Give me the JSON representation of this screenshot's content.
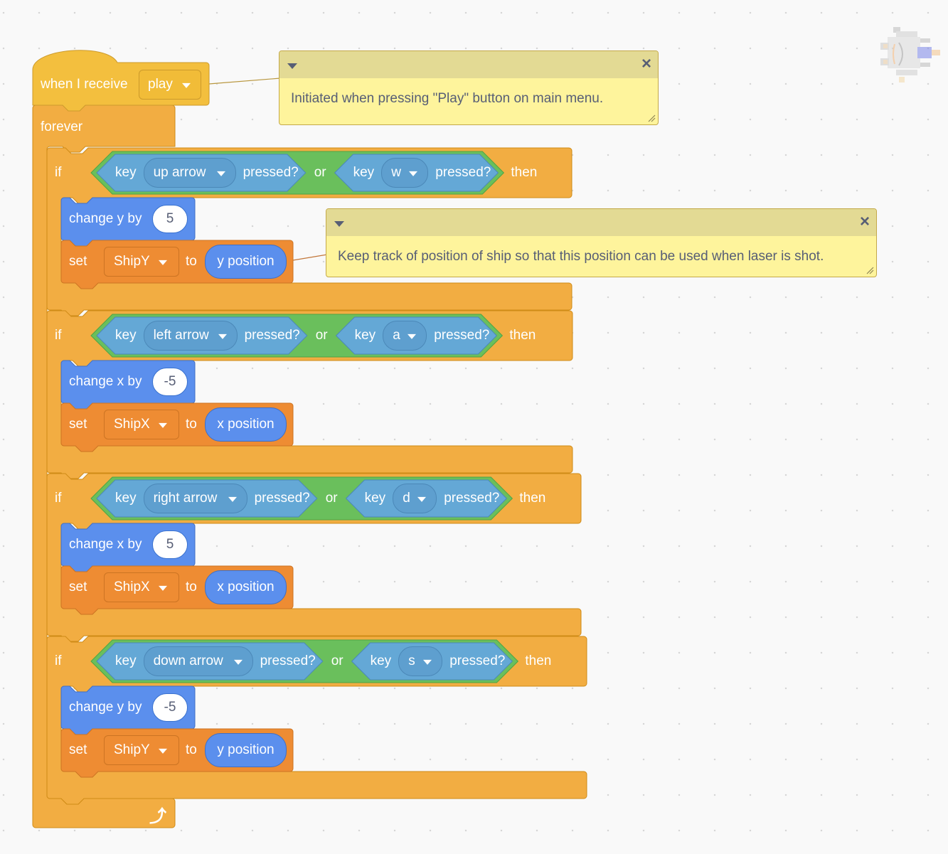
{
  "workspace": {
    "sprite_thumbnail": "spaceship-sprite-icon",
    "colors": {
      "events": "#f1bc38",
      "control": "#f2ad42",
      "motion": "#5b8fed",
      "variables": "#ee8c33",
      "operators": "#6abf5c",
      "sensing": "#64a8d6",
      "comment_body": "#fef49c",
      "comment_header": "#e3da94"
    }
  },
  "script": {
    "hat": {
      "label": "when I receive",
      "message": "play"
    },
    "forever_label": "forever",
    "loop_icon": "loop-arrow-icon",
    "if_blocks": [
      {
        "if_label": "if",
        "then_label": "then",
        "or_label": "or",
        "left": {
          "key_label": "key",
          "key": "up arrow",
          "pressed_label": "pressed?"
        },
        "right": {
          "key_label": "key",
          "key": "w",
          "pressed_label": "pressed?"
        },
        "change": {
          "label": "change y by",
          "value": "5"
        },
        "set": {
          "set_label": "set",
          "variable": "ShipY",
          "to_label": "to",
          "reporter": "y position"
        }
      },
      {
        "if_label": "if",
        "then_label": "then",
        "or_label": "or",
        "left": {
          "key_label": "key",
          "key": "left arrow",
          "pressed_label": "pressed?"
        },
        "right": {
          "key_label": "key",
          "key": "a",
          "pressed_label": "pressed?"
        },
        "change": {
          "label": "change x by",
          "value": "-5"
        },
        "set": {
          "set_label": "set",
          "variable": "ShipX",
          "to_label": "to",
          "reporter": "x position"
        }
      },
      {
        "if_label": "if",
        "then_label": "then",
        "or_label": "or",
        "left": {
          "key_label": "key",
          "key": "right arrow",
          "pressed_label": "pressed?"
        },
        "right": {
          "key_label": "key",
          "key": "d",
          "pressed_label": "pressed?"
        },
        "change": {
          "label": "change x by",
          "value": "5"
        },
        "set": {
          "set_label": "set",
          "variable": "ShipX",
          "to_label": "to",
          "reporter": "x position"
        }
      },
      {
        "if_label": "if",
        "then_label": "then",
        "or_label": "or",
        "left": {
          "key_label": "key",
          "key": "down arrow",
          "pressed_label": "pressed?"
        },
        "right": {
          "key_label": "key",
          "key": "s",
          "pressed_label": "pressed?"
        },
        "change": {
          "label": "change y by",
          "value": "-5"
        },
        "set": {
          "set_label": "set",
          "variable": "ShipY",
          "to_label": "to",
          "reporter": "y position"
        }
      }
    ]
  },
  "comments": [
    {
      "text": "Initiated when pressing \"Play\" button on main menu.",
      "close_icon": "×"
    },
    {
      "text": "Keep track of position of ship so that this position can be used when laser is shot.",
      "close_icon": "×"
    }
  ]
}
